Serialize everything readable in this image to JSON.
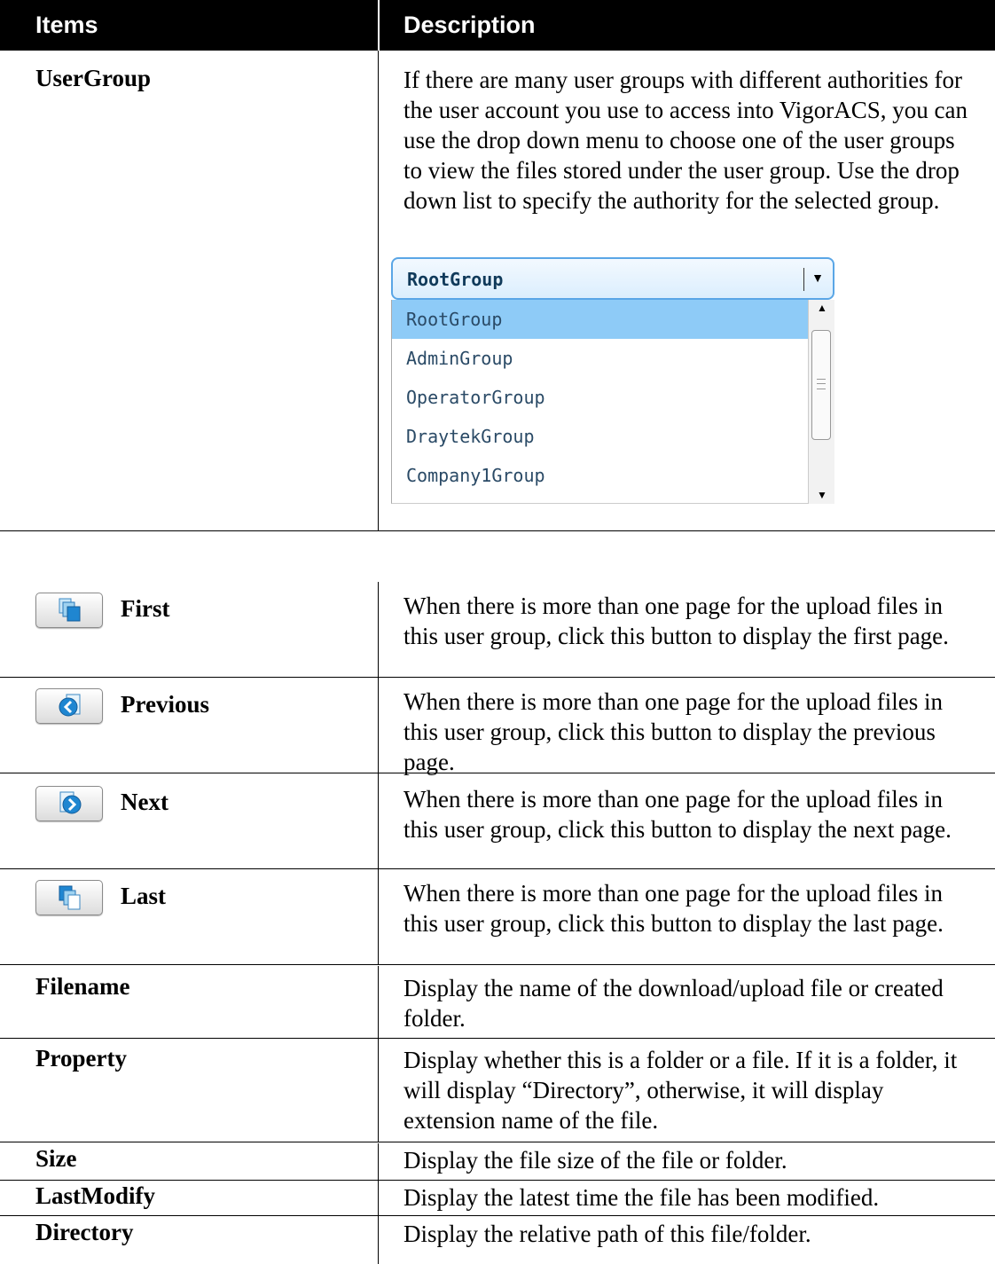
{
  "header": {
    "items": "Items",
    "description": "Description"
  },
  "usergroup": {
    "label": "UserGroup",
    "description": "If there are many user groups with different authorities for the user account you use to access into VigorACS, you can use the drop down menu to choose one of the user groups to view the files stored under the user group. Use the drop down list to specify the authority for the selected group.",
    "dropdown": {
      "selected": "RootGroup",
      "options": [
        "RootGroup",
        "AdminGroup",
        "OperatorGroup",
        "DraytekGroup",
        "Company1Group"
      ]
    }
  },
  "first": {
    "label": "First",
    "icon": "first-page-icon",
    "description": "When there is more than one page for the upload files in this user group, click this button to display the first page."
  },
  "previous": {
    "label": "Previous",
    "icon": "previous-page-icon",
    "description": "When there is more than one page for the upload files in this user group, click this button to display the previous page."
  },
  "next": {
    "label": "Next",
    "icon": "next-page-icon",
    "description": "When there is more than one page for the upload files in this user group, click this button to display the next page."
  },
  "last": {
    "label": "Last",
    "icon": "last-page-icon",
    "description": "When there is more than one page for the upload files in this user group, click this button to display the last page."
  },
  "filename": {
    "label": "Filename",
    "description": "Display the name of the download/upload file or created folder."
  },
  "property": {
    "label": "Property",
    "description": "Display whether this is a folder or a file. If it is a folder, it will display “Directory”, otherwise, it will display extension name of the file."
  },
  "size": {
    "label": "Size",
    "description": "Display the file size of the file or folder."
  },
  "lastmodify": {
    "label": "LastModify",
    "description": "Display the latest time the file has been modified."
  },
  "directory": {
    "label": "Directory",
    "description": "Display the relative path of this file/folder."
  },
  "colors": {
    "header_bg": "#000000",
    "dropdown_border": "#5aa6e6",
    "option_selected": "#8ecbf7"
  }
}
